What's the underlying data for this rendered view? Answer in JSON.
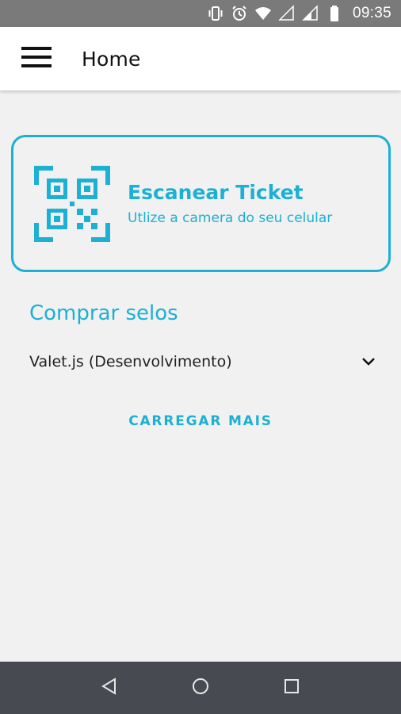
{
  "status_bar": {
    "time": "09:35",
    "icons": [
      "vibrate-icon",
      "alarm-icon",
      "wifi-icon",
      "signal-icon",
      "signal-icon",
      "battery-icon"
    ]
  },
  "app_bar": {
    "title": "Home",
    "menu_icon": "menu-icon"
  },
  "scan_card": {
    "icon": "qr-scan-icon",
    "title": "Escanear Ticket",
    "subtitle": "Utlize a camera do seu celular"
  },
  "section": {
    "title": "Comprar selos"
  },
  "list": {
    "items": [
      {
        "label": "Valet.js (Desenvolvimento)",
        "icon": "chevron-down-icon"
      }
    ]
  },
  "load_more": {
    "label": "CARREGAR MAIS"
  },
  "nav_bar": {
    "buttons": [
      "back-icon",
      "home-icon",
      "recents-icon"
    ]
  },
  "colors": {
    "accent": "#1cb0d4",
    "status_bar": "#7a7a7a",
    "nav_bar": "#474b51",
    "background": "#f1f1f1"
  }
}
